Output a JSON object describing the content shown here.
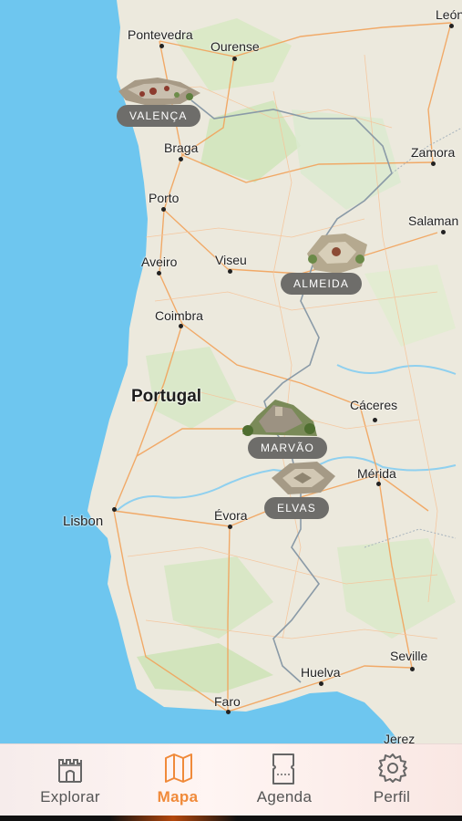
{
  "map": {
    "colors": {
      "sea": "#6ec6ef",
      "land": "#ece9dd",
      "forest": "#cfe3b8",
      "road": "#f2a35b",
      "border": "#8a9aa7"
    },
    "country_label": "Portugal",
    "cities": [
      {
        "key": "pontevedra",
        "name": "Pontevedra"
      },
      {
        "key": "ourense",
        "name": "Ourense"
      },
      {
        "key": "leon",
        "name": "León"
      },
      {
        "key": "braga",
        "name": "Braga"
      },
      {
        "key": "zamora",
        "name": "Zamora"
      },
      {
        "key": "porto",
        "name": "Porto"
      },
      {
        "key": "salamanca",
        "name": "Salaman"
      },
      {
        "key": "aveiro",
        "name": "Aveiro"
      },
      {
        "key": "viseu",
        "name": "Viseu"
      },
      {
        "key": "coimbra",
        "name": "Coimbra"
      },
      {
        "key": "caceres",
        "name": "Cáceres"
      },
      {
        "key": "merida",
        "name": "Mérida"
      },
      {
        "key": "lisbon",
        "name": "Lisbon"
      },
      {
        "key": "evora",
        "name": "Évora"
      },
      {
        "key": "seville",
        "name": "Seville"
      },
      {
        "key": "huelva",
        "name": "Huelva"
      },
      {
        "key": "faro",
        "name": "Faro"
      },
      {
        "key": "jerez",
        "name": "Jerez"
      }
    ],
    "markers": [
      {
        "key": "valenca",
        "label": "VALENÇA"
      },
      {
        "key": "almeida",
        "label": "ALMEIDA"
      },
      {
        "key": "marvao",
        "label": "MARVÃO"
      },
      {
        "key": "elvas",
        "label": "ELVAS"
      }
    ]
  },
  "tabbar": {
    "active_color": "#f08a3a",
    "tabs": [
      {
        "key": "explorar",
        "label": "Explorar",
        "icon": "castle-icon"
      },
      {
        "key": "mapa",
        "label": "Mapa",
        "icon": "map-icon",
        "active": true
      },
      {
        "key": "agenda",
        "label": "Agenda",
        "icon": "ticket-icon"
      },
      {
        "key": "perfil",
        "label": "Perfil",
        "icon": "gear-icon"
      }
    ]
  }
}
